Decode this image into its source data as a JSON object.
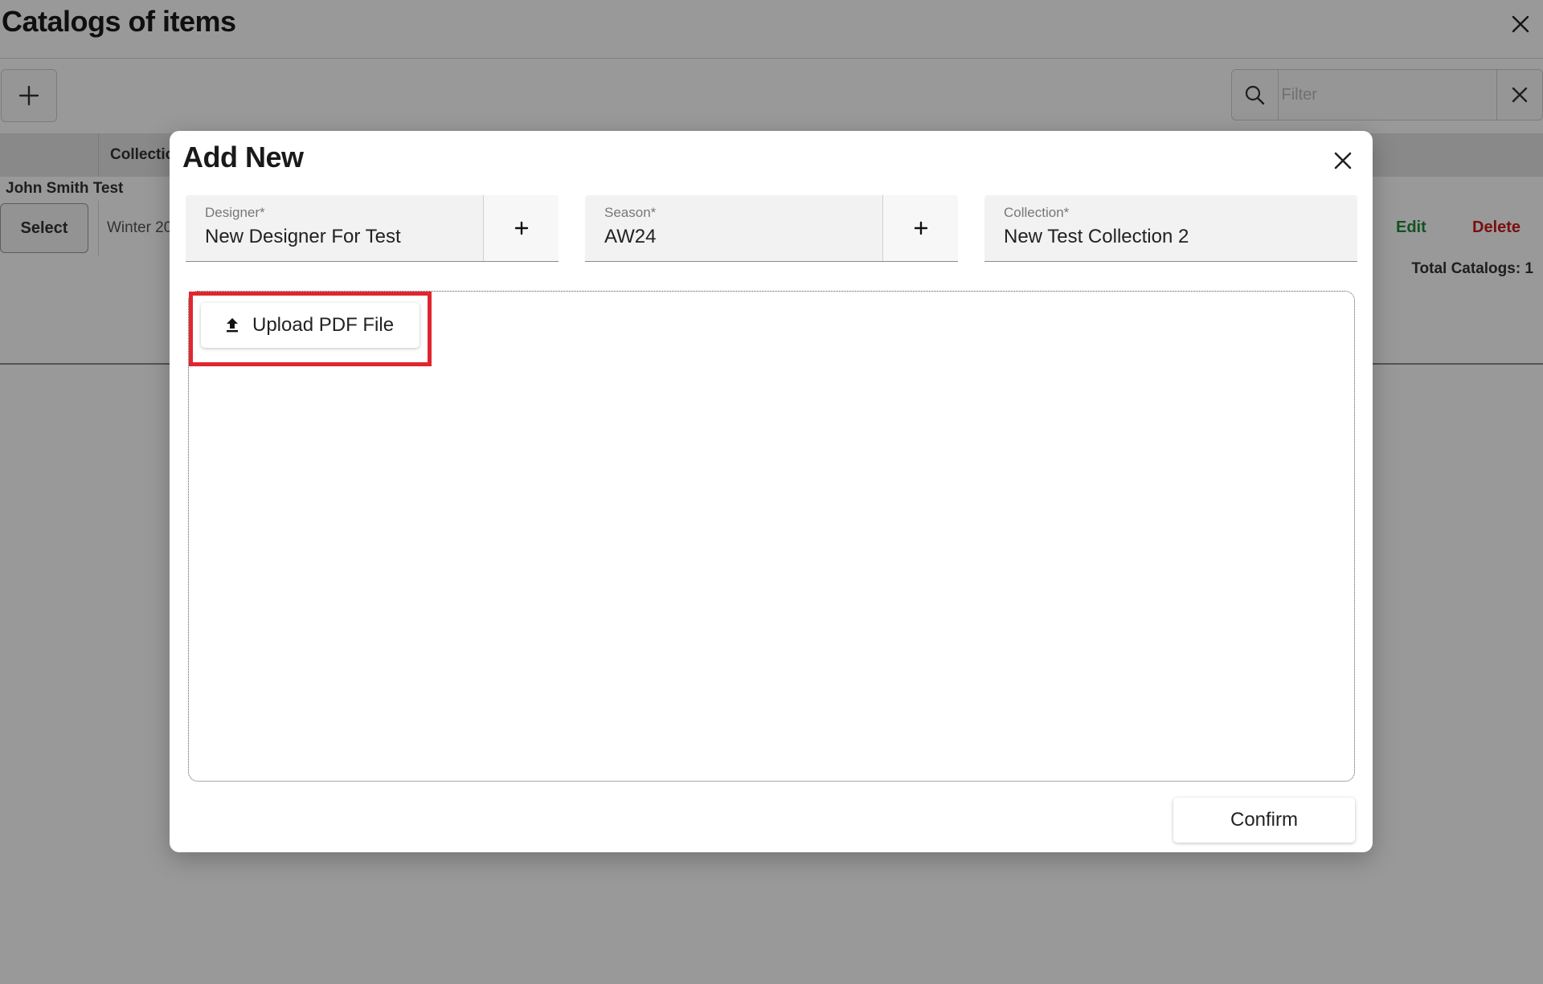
{
  "page": {
    "title": "Catalogs of items",
    "filter": {
      "placeholder": "Filter"
    },
    "table": {
      "column_header": "Collectio",
      "group_label": "John Smith Test",
      "row": {
        "select_label": "Select",
        "cell_text": "Winter 20",
        "edit_label": "Edit",
        "delete_label": "Delete"
      },
      "totals": "Total Catalogs: 1"
    }
  },
  "modal": {
    "title": "Add New",
    "fields": {
      "designer": {
        "label": "Designer*",
        "value": "New Designer For Test"
      },
      "season": {
        "label": "Season*",
        "value": "AW24"
      },
      "collection": {
        "label": "Collection*",
        "value": "New Test Collection 2"
      }
    },
    "upload_label": "Upload PDF File",
    "confirm_label": "Confirm"
  },
  "colors": {
    "edit": "#1e8a3a",
    "delete": "#cc1a1a",
    "highlight": "#e0262f"
  },
  "icons": [
    "close-icon",
    "plus-icon",
    "search-icon",
    "upload-icon"
  ]
}
